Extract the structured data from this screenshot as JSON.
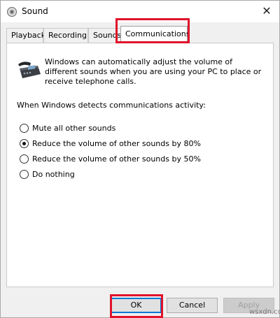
{
  "window": {
    "title": "Sound",
    "close_glyph": "✕"
  },
  "tabs": [
    {
      "label": "Playback"
    },
    {
      "label": "Recording"
    },
    {
      "label": "Sounds"
    },
    {
      "label": "Communications"
    }
  ],
  "active_tab": "Communications",
  "communications": {
    "description": "Windows can automatically adjust the volume of different sounds when you are using your PC to place or receive telephone calls.",
    "prompt": "When Windows detects communications activity:",
    "options": [
      {
        "label": "Mute all other sounds",
        "checked": false
      },
      {
        "label": "Reduce the volume of other sounds by 80%",
        "checked": true
      },
      {
        "label": "Reduce the volume of other sounds by 50%",
        "checked": false
      },
      {
        "label": "Do nothing",
        "checked": false
      }
    ]
  },
  "buttons": {
    "ok": "OK",
    "cancel": "Cancel",
    "apply": "Apply"
  },
  "watermark": "wsxdn.com",
  "colors": {
    "highlight": "#e0132a",
    "default_button_border": "#0078d7"
  },
  "icons": {
    "title": "speaker-icon",
    "phone": "telephone-icon",
    "close": "close-icon"
  }
}
